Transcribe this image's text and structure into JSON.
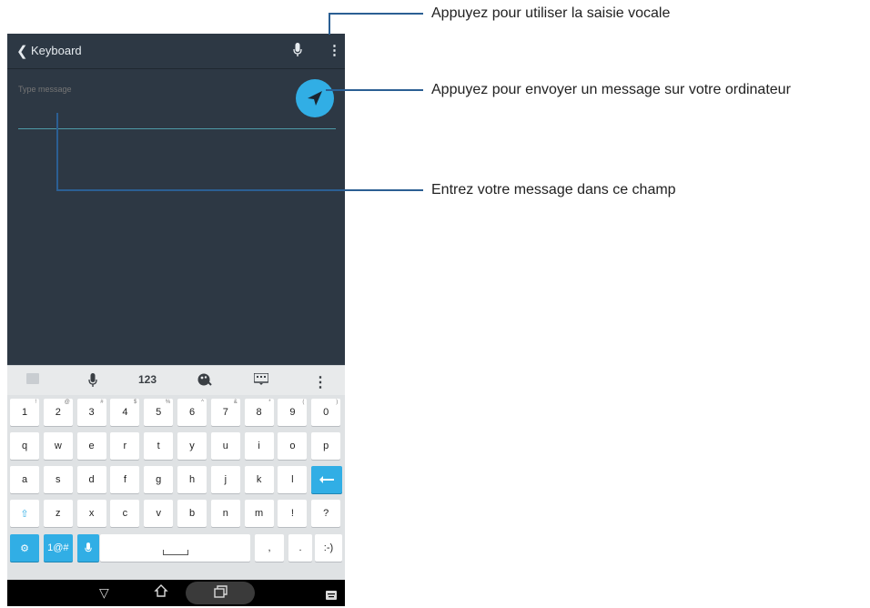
{
  "app_bar": {
    "back_glyph": "❮",
    "title": "Keyboard",
    "mic_icon": "microphone-icon",
    "more_icon": "more-vert-icon"
  },
  "message": {
    "placeholder": "Type message"
  },
  "send_button": {
    "icon": "send-icon",
    "color": "#31aee5"
  },
  "keyboard_toolbar": {
    "items": [
      {
        "name": "keyboard-hide-icon",
        "label": ""
      },
      {
        "name": "microphone-icon",
        "label": ""
      },
      {
        "name": "numeric-layout-button",
        "label": "123"
      },
      {
        "name": "theme-palette-icon",
        "label": ""
      },
      {
        "name": "keyboard-layout-icon",
        "label": ""
      },
      {
        "name": "more-vert-icon",
        "label": "⋮"
      }
    ]
  },
  "keys": {
    "row1": [
      "1",
      "2",
      "3",
      "4",
      "5",
      "6",
      "7",
      "8",
      "9",
      "0"
    ],
    "row1_sub": [
      "!",
      "@",
      "#",
      "$",
      "%",
      "^",
      "&",
      "*",
      "(",
      ")"
    ],
    "row2": [
      "q",
      "w",
      "e",
      "r",
      "t",
      "y",
      "u",
      "i",
      "o",
      "p"
    ],
    "row3": [
      "a",
      "s",
      "d",
      "f",
      "g",
      "h",
      "j",
      "k",
      "l"
    ],
    "row4": [
      "z",
      "x",
      "c",
      "v",
      "b",
      "n",
      "m",
      "!",
      "?"
    ],
    "symbols_label": "1@#",
    "emoticon_label": ":-)",
    "comma_label": ",",
    "period_label": "."
  },
  "callouts": {
    "voice": "Appuyez pour utiliser la saisie vocale",
    "send": "Appuyez pour envoyer un message sur votre ordinateur",
    "field": "Entrez votre message dans ce champ"
  },
  "colors": {
    "app_bg": "#2d3844",
    "accent": "#31aee5",
    "callout_line": "#2b5f93"
  }
}
